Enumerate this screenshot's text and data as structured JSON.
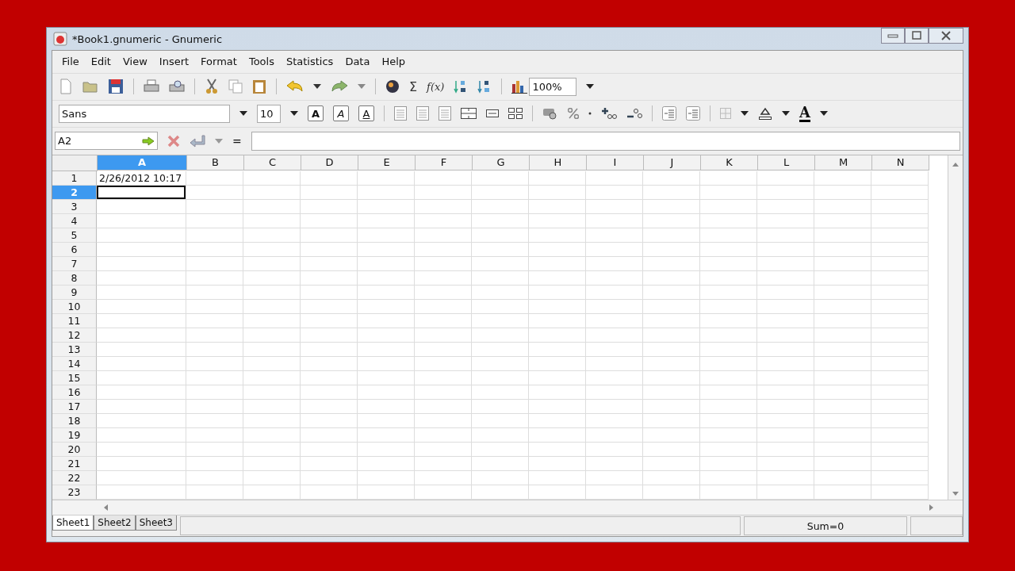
{
  "window": {
    "title": "*Book1.gnumeric - Gnumeric"
  },
  "menu": [
    "File",
    "Edit",
    "View",
    "Insert",
    "Format",
    "Tools",
    "Statistics",
    "Data",
    "Help"
  ],
  "toolbar": {
    "sum_button": "Σ",
    "function_button": "f(x)",
    "zoom": "100%"
  },
  "format_bar": {
    "font": "Sans",
    "size": "10",
    "style_buttons": [
      {
        "label": "A",
        "kind": "bold"
      },
      {
        "label": "A",
        "kind": "italic"
      },
      {
        "label": "A",
        "kind": "underline"
      }
    ],
    "font_color": "A"
  },
  "formula_bar": {
    "cell_ref": "A2",
    "equals": "="
  },
  "columns": [
    {
      "label": "A",
      "selected": true
    },
    {
      "label": "B",
      "selected": false
    },
    {
      "label": "C",
      "selected": false
    },
    {
      "label": "D",
      "selected": false
    },
    {
      "label": "E",
      "selected": false
    },
    {
      "label": "F",
      "selected": false
    },
    {
      "label": "G",
      "selected": false
    },
    {
      "label": "H",
      "selected": false
    },
    {
      "label": "I",
      "selected": false
    },
    {
      "label": "J",
      "selected": false
    },
    {
      "label": "K",
      "selected": false
    },
    {
      "label": "L",
      "selected": false
    },
    {
      "label": "M",
      "selected": false
    },
    {
      "label": "N",
      "selected": false
    }
  ],
  "rows": [
    {
      "label": "1",
      "selected": false,
      "cells": [
        "2/26/2012 10:17"
      ]
    },
    {
      "label": "2",
      "selected": true
    },
    {
      "label": "3",
      "selected": false
    },
    {
      "label": "4",
      "selected": false
    },
    {
      "label": "5",
      "selected": false
    },
    {
      "label": "6",
      "selected": false
    },
    {
      "label": "7",
      "selected": false
    },
    {
      "label": "8",
      "selected": false
    },
    {
      "label": "9",
      "selected": false
    },
    {
      "label": "10",
      "selected": false
    },
    {
      "label": "11",
      "selected": false
    },
    {
      "label": "12",
      "selected": false
    },
    {
      "label": "13",
      "selected": false
    },
    {
      "label": "14",
      "selected": false
    },
    {
      "label": "15",
      "selected": false
    },
    {
      "label": "16",
      "selected": false
    },
    {
      "label": "17",
      "selected": false
    },
    {
      "label": "18",
      "selected": false
    },
    {
      "label": "19",
      "selected": false
    },
    {
      "label": "20",
      "selected": false
    },
    {
      "label": "21",
      "selected": false
    },
    {
      "label": "22",
      "selected": false
    },
    {
      "label": "23",
      "selected": false
    }
  ],
  "sheets": [
    {
      "label": "Sheet1",
      "selected": true
    },
    {
      "label": "Sheet2",
      "selected": false
    },
    {
      "label": "Sheet3",
      "selected": false
    }
  ],
  "status_bar": {
    "sum": "Sum=0"
  }
}
